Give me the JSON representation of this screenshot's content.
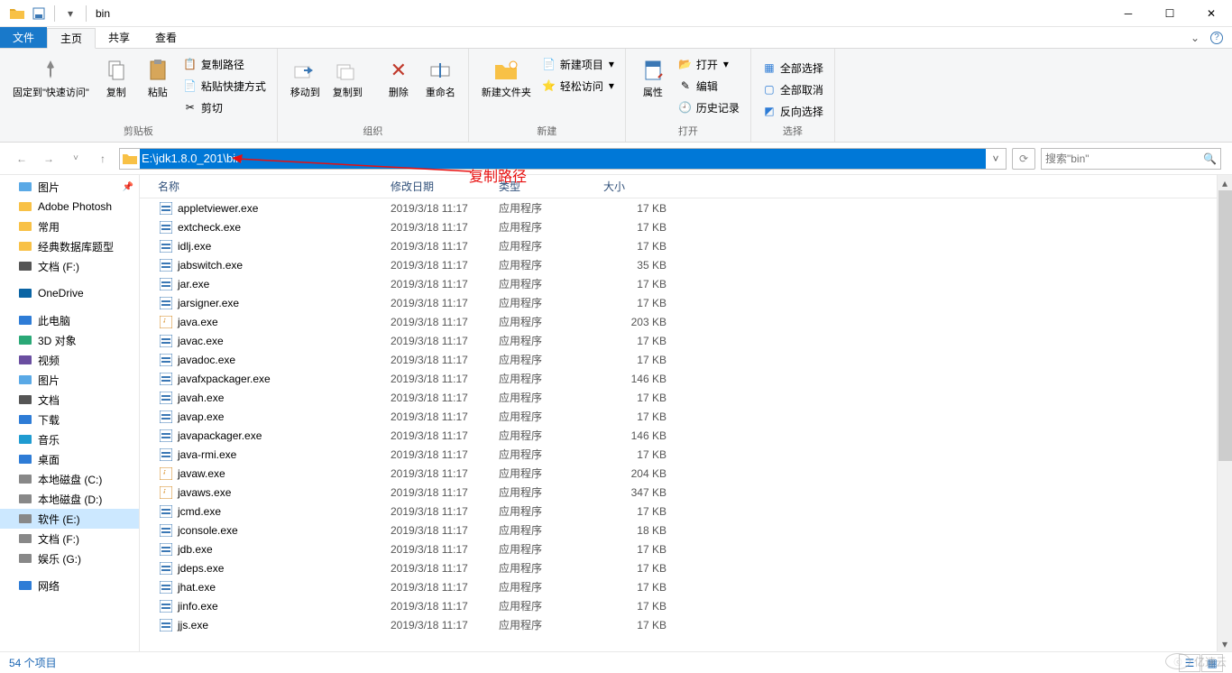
{
  "title_parts": {
    "sep": "|",
    "name": "bin"
  },
  "tabs": {
    "file": "文件",
    "home": "主页",
    "share": "共享",
    "view": "查看"
  },
  "ribbon": {
    "clipboard": {
      "label": "剪贴板",
      "pin": "固定到\"快速访问\"",
      "copy": "复制",
      "paste": "粘贴",
      "copypath": "复制路径",
      "pasteshort": "粘贴快捷方式",
      "cut": "剪切"
    },
    "organize": {
      "label": "组织",
      "moveto": "移动到",
      "copyto": "复制到",
      "delete": "删除",
      "rename": "重命名"
    },
    "new": {
      "label": "新建",
      "newfolder": "新建文件夹",
      "newitem": "新建项目",
      "easyaccess": "轻松访问"
    },
    "open": {
      "label": "打开",
      "properties": "属性",
      "open": "打开",
      "edit": "编辑",
      "history": "历史记录"
    },
    "select": {
      "label": "选择",
      "all": "全部选择",
      "none": "全部取消",
      "invert": "反向选择"
    }
  },
  "address": "E:\\jdk1.8.0_201\\bin",
  "search_placeholder": "搜索\"bin\"",
  "annotation_text": "复制路径",
  "columns": {
    "name": "名称",
    "modified": "修改日期",
    "type": "类型",
    "size": "大小"
  },
  "tree_items": [
    {
      "label": "图片",
      "color": "#5aa9e6",
      "pin": true
    },
    {
      "label": "Adobe Photosh",
      "color": "#f8c146"
    },
    {
      "label": "常用",
      "color": "#f8c146"
    },
    {
      "label": "经典数据库题型",
      "color": "#f8c146"
    },
    {
      "label": "文档 (F:)",
      "color": "#555"
    },
    {
      "spacer": true
    },
    {
      "label": "OneDrive",
      "color": "#0a64a4"
    },
    {
      "spacer": true
    },
    {
      "label": "此电脑",
      "color": "#2e7cd6"
    },
    {
      "label": "3D 对象",
      "color": "#2aa876"
    },
    {
      "label": "视频",
      "color": "#6a4ea0"
    },
    {
      "label": "图片",
      "color": "#5aa9e6"
    },
    {
      "label": "文档",
      "color": "#555"
    },
    {
      "label": "下载",
      "color": "#2e7cd6"
    },
    {
      "label": "音乐",
      "color": "#1f9bd1"
    },
    {
      "label": "桌面",
      "color": "#2e7cd6"
    },
    {
      "label": "本地磁盘 (C:)",
      "color": "#888"
    },
    {
      "label": "本地磁盘 (D:)",
      "color": "#888"
    },
    {
      "label": "软件 (E:)",
      "color": "#888",
      "selected": true
    },
    {
      "label": "文档 (F:)",
      "color": "#888"
    },
    {
      "label": "娱乐 (G:)",
      "color": "#888"
    },
    {
      "spacer": true
    },
    {
      "label": "网络",
      "color": "#2e7cd6"
    }
  ],
  "files": [
    {
      "name": "appletviewer.exe",
      "date": "2019/3/18 11:17",
      "type": "应用程序",
      "size": "17 KB",
      "java": false
    },
    {
      "name": "extcheck.exe",
      "date": "2019/3/18 11:17",
      "type": "应用程序",
      "size": "17 KB",
      "java": false
    },
    {
      "name": "idlj.exe",
      "date": "2019/3/18 11:17",
      "type": "应用程序",
      "size": "17 KB",
      "java": false
    },
    {
      "name": "jabswitch.exe",
      "date": "2019/3/18 11:17",
      "type": "应用程序",
      "size": "35 KB",
      "java": false
    },
    {
      "name": "jar.exe",
      "date": "2019/3/18 11:17",
      "type": "应用程序",
      "size": "17 KB",
      "java": false
    },
    {
      "name": "jarsigner.exe",
      "date": "2019/3/18 11:17",
      "type": "应用程序",
      "size": "17 KB",
      "java": false
    },
    {
      "name": "java.exe",
      "date": "2019/3/18 11:17",
      "type": "应用程序",
      "size": "203 KB",
      "java": true
    },
    {
      "name": "javac.exe",
      "date": "2019/3/18 11:17",
      "type": "应用程序",
      "size": "17 KB",
      "java": false
    },
    {
      "name": "javadoc.exe",
      "date": "2019/3/18 11:17",
      "type": "应用程序",
      "size": "17 KB",
      "java": false
    },
    {
      "name": "javafxpackager.exe",
      "date": "2019/3/18 11:17",
      "type": "应用程序",
      "size": "146 KB",
      "java": false
    },
    {
      "name": "javah.exe",
      "date": "2019/3/18 11:17",
      "type": "应用程序",
      "size": "17 KB",
      "java": false
    },
    {
      "name": "javap.exe",
      "date": "2019/3/18 11:17",
      "type": "应用程序",
      "size": "17 KB",
      "java": false
    },
    {
      "name": "javapackager.exe",
      "date": "2019/3/18 11:17",
      "type": "应用程序",
      "size": "146 KB",
      "java": false
    },
    {
      "name": "java-rmi.exe",
      "date": "2019/3/18 11:17",
      "type": "应用程序",
      "size": "17 KB",
      "java": false
    },
    {
      "name": "javaw.exe",
      "date": "2019/3/18 11:17",
      "type": "应用程序",
      "size": "204 KB",
      "java": true
    },
    {
      "name": "javaws.exe",
      "date": "2019/3/18 11:17",
      "type": "应用程序",
      "size": "347 KB",
      "java": true
    },
    {
      "name": "jcmd.exe",
      "date": "2019/3/18 11:17",
      "type": "应用程序",
      "size": "17 KB",
      "java": false
    },
    {
      "name": "jconsole.exe",
      "date": "2019/3/18 11:17",
      "type": "应用程序",
      "size": "18 KB",
      "java": false
    },
    {
      "name": "jdb.exe",
      "date": "2019/3/18 11:17",
      "type": "应用程序",
      "size": "17 KB",
      "java": false
    },
    {
      "name": "jdeps.exe",
      "date": "2019/3/18 11:17",
      "type": "应用程序",
      "size": "17 KB",
      "java": false
    },
    {
      "name": "jhat.exe",
      "date": "2019/3/18 11:17",
      "type": "应用程序",
      "size": "17 KB",
      "java": false
    },
    {
      "name": "jinfo.exe",
      "date": "2019/3/18 11:17",
      "type": "应用程序",
      "size": "17 KB",
      "java": false
    },
    {
      "name": "jjs.exe",
      "date": "2019/3/18 11:17",
      "type": "应用程序",
      "size": "17 KB",
      "java": false
    }
  ],
  "status_text": "54 个项目",
  "watermark": "亿速云"
}
